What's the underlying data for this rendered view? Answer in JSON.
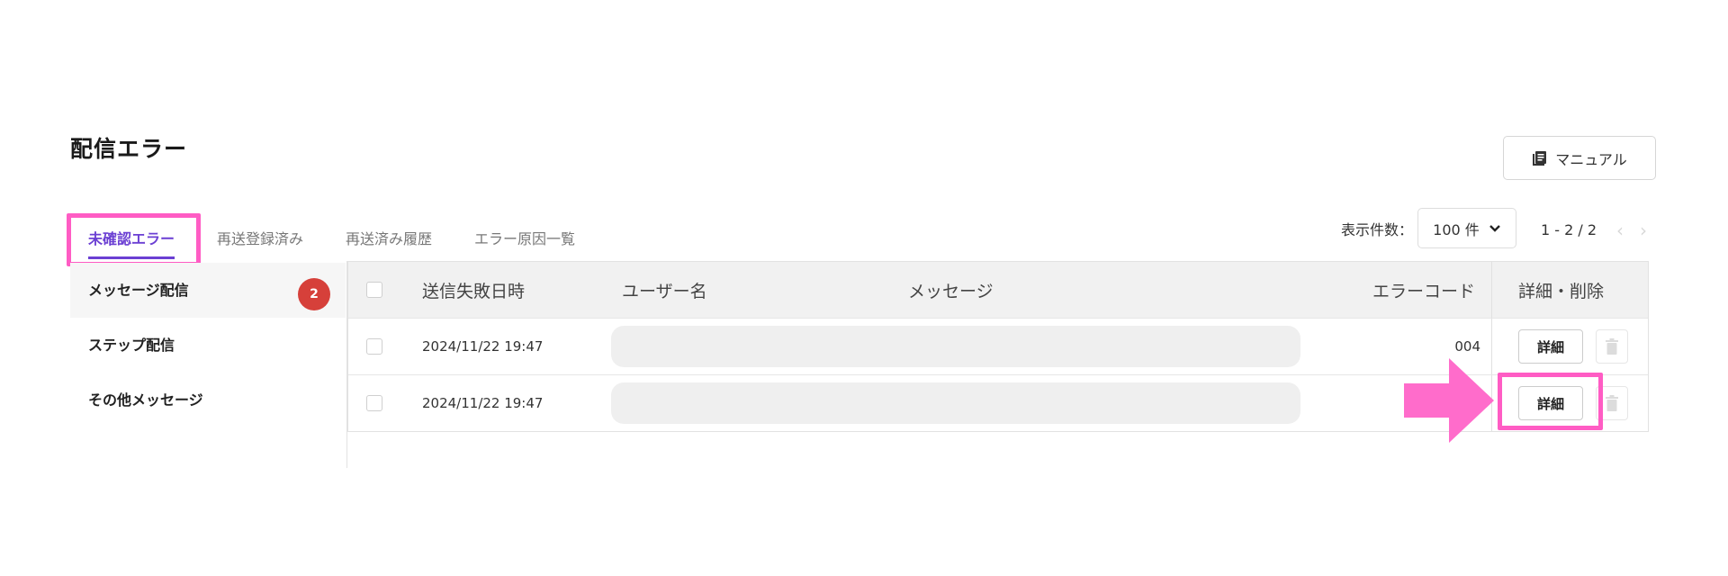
{
  "page": {
    "title": "配信エラー"
  },
  "header": {
    "manual_label": "マニュアル",
    "manual_icon": "book-icon"
  },
  "tabs": [
    {
      "label": "未確認エラー",
      "active": true
    },
    {
      "label": "再送登録済み",
      "active": false
    },
    {
      "label": "再送済み履歴",
      "active": false
    },
    {
      "label": "エラー原因一覧",
      "active": false
    }
  ],
  "pagination": {
    "per_page_label": "表示件数：",
    "per_page_value": "100 件",
    "range": "1 - 2 / 2",
    "prev_icon": "chevron-left-icon",
    "next_icon": "chevron-right-icon"
  },
  "sidebar": {
    "items": [
      {
        "label": "メッセージ配信",
        "badge": "2",
        "active": true
      },
      {
        "label": "ステップ配信",
        "active": false
      },
      {
        "label": "その他メッセージ",
        "active": false
      }
    ]
  },
  "table": {
    "columns": {
      "sent_failed_at": "送信失敗日時",
      "user_name": "ユーザー名",
      "message": "メッセージ",
      "error_code": "エラーコード",
      "actions": "詳細・削除"
    },
    "rows": [
      {
        "sent_failed_at": "2024/11/22 19:47",
        "user_name": "",
        "message": "",
        "error_code": "004",
        "detail_label": "詳細"
      },
      {
        "sent_failed_at": "2024/11/22 19:47",
        "user_name": "",
        "message": "",
        "error_code": "",
        "detail_label": "詳細"
      }
    ]
  },
  "annotations": {
    "highlight_color": "#ff5cc4"
  },
  "colors": {
    "accent": "#6b3fd3",
    "badge": "#d6403a"
  }
}
